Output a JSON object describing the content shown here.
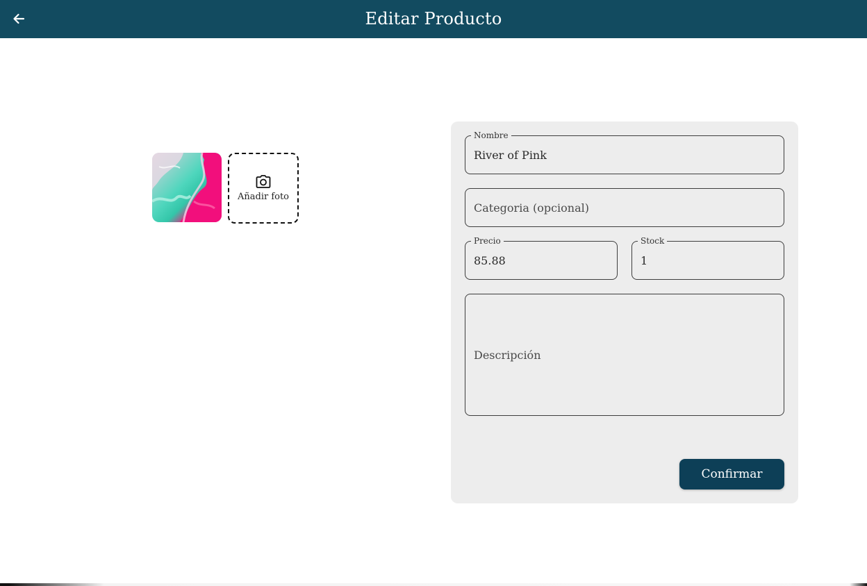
{
  "appbar": {
    "title": "Editar Producto",
    "back_icon": "arrow-left-icon",
    "color": "#124b60"
  },
  "photos": {
    "add_label": "Añadir foto",
    "add_icon": "camera-icon"
  },
  "form": {
    "name": {
      "label": "Nombre",
      "value": "River of Pink"
    },
    "category": {
      "placeholder": "Categoria (opcional)"
    },
    "price": {
      "label": "Precio",
      "value": "85.88"
    },
    "stock": {
      "label": "Stock",
      "value": "1"
    },
    "description": {
      "placeholder": "Descripción"
    },
    "confirm_label": "Confirmar",
    "confirm_color": "#0d3f57"
  }
}
